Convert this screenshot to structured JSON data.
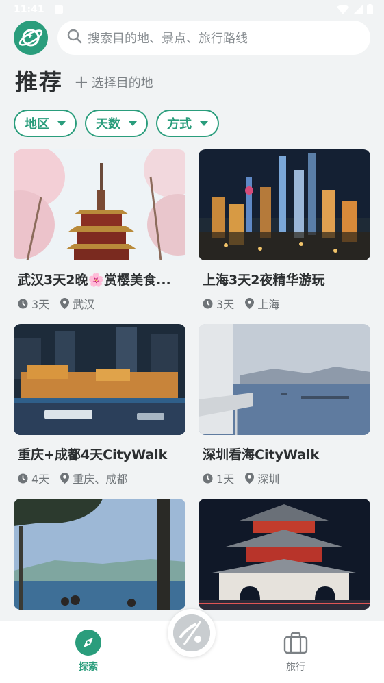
{
  "status_bar": {
    "time": "11:41"
  },
  "search": {
    "placeholder": "搜索目的地、景点、旅行路线"
  },
  "header": {
    "title": "推荐",
    "choose_destination": "选择目的地"
  },
  "filters": [
    {
      "label": "地区"
    },
    {
      "label": "天数"
    },
    {
      "label": "方式"
    }
  ],
  "trips": [
    {
      "title": "武汉3天2晚🌸赏樱美食...",
      "days": "3天",
      "location": "武汉",
      "image": "pagoda-cherry-blossom"
    },
    {
      "title": "上海3天2夜精华游玩",
      "days": "3天",
      "location": "上海",
      "image": "shanghai-night-skyline"
    },
    {
      "title": "重庆+成都4天CityWalk",
      "days": "4天",
      "location": "重庆、成都",
      "image": "chongqing-night-riverside"
    },
    {
      "title": "深圳看海CityWalk",
      "days": "1天",
      "location": "深圳",
      "image": "shenzhen-bay-sea"
    },
    {
      "title": "",
      "days": "",
      "location": "",
      "image": "lake-with-palm-trees"
    },
    {
      "title": "",
      "days": "",
      "location": "",
      "image": "xian-bell-tower-night"
    }
  ],
  "bottom_nav": {
    "explore_label": "探索",
    "trip_label": "旅行"
  },
  "colors": {
    "accent": "#2a9d7c",
    "background": "#f1f3f4"
  }
}
